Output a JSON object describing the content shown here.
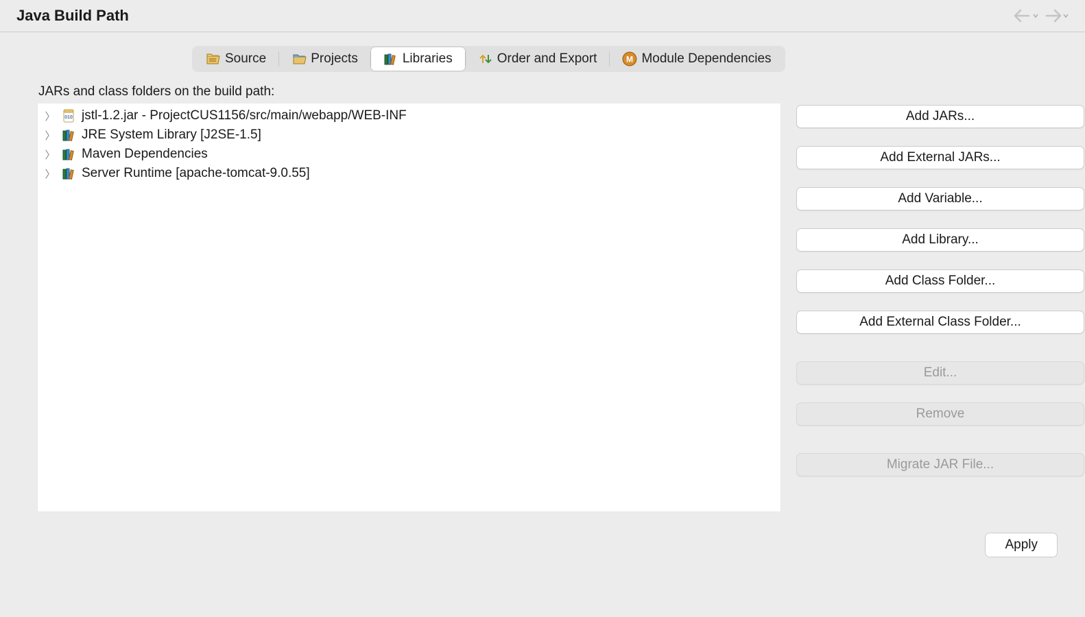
{
  "header": {
    "title": "Java Build Path"
  },
  "tabs": [
    {
      "label": "Source"
    },
    {
      "label": "Projects"
    },
    {
      "label": "Libraries"
    },
    {
      "label": "Order and Export"
    },
    {
      "label": "Module Dependencies"
    }
  ],
  "subtitle": "JARs and class folders on the build path:",
  "tree": [
    {
      "label": "jstl-1.2.jar - ProjectCUS1156/src/main/webapp/WEB-INF",
      "icon": "jar"
    },
    {
      "label": "JRE System Library [J2SE-1.5]",
      "icon": "library"
    },
    {
      "label": "Maven Dependencies",
      "icon": "library"
    },
    {
      "label": "Server Runtime [apache-tomcat-9.0.55]",
      "icon": "library"
    }
  ],
  "buttons": {
    "add_jars": "Add JARs...",
    "add_external_jars": "Add External JARs...",
    "add_variable": "Add Variable...",
    "add_library": "Add Library...",
    "add_class_folder": "Add Class Folder...",
    "add_external_class_folder": "Add External Class Folder...",
    "edit": "Edit...",
    "remove": "Remove",
    "migrate": "Migrate JAR File...",
    "apply": "Apply"
  }
}
